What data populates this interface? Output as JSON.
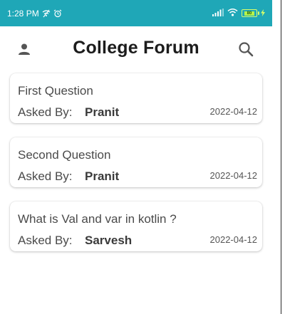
{
  "status_bar": {
    "time": "1:28 PM",
    "notification_icons": [
      "wifi-off-icon",
      "alarm-icon"
    ],
    "right_icons": [
      "signal-icon",
      "wifi-icon",
      "battery-icon",
      "charging-icon"
    ],
    "battery_level": "80"
  },
  "header": {
    "title": "College Forum",
    "left_icon": "person-icon",
    "right_icon": "search-icon"
  },
  "questions": [
    {
      "title": "First Question",
      "asked_by_label": "Asked By:",
      "author": "Pranit",
      "date": "2022-04-12"
    },
    {
      "title": "Second Question",
      "asked_by_label": "Asked By:",
      "author": "Pranit",
      "date": "2022-04-12"
    },
    {
      "title": "What is Val and var in kotlin ?",
      "asked_by_label": "Asked By:",
      "author": "Sarvesh",
      "date": "2022-04-12"
    }
  ],
  "colors": {
    "status_bar": "#1fa7b7",
    "title_text": "#1c1c1c",
    "body_text": "#4a4a4a",
    "battery": "#b6f24a"
  }
}
